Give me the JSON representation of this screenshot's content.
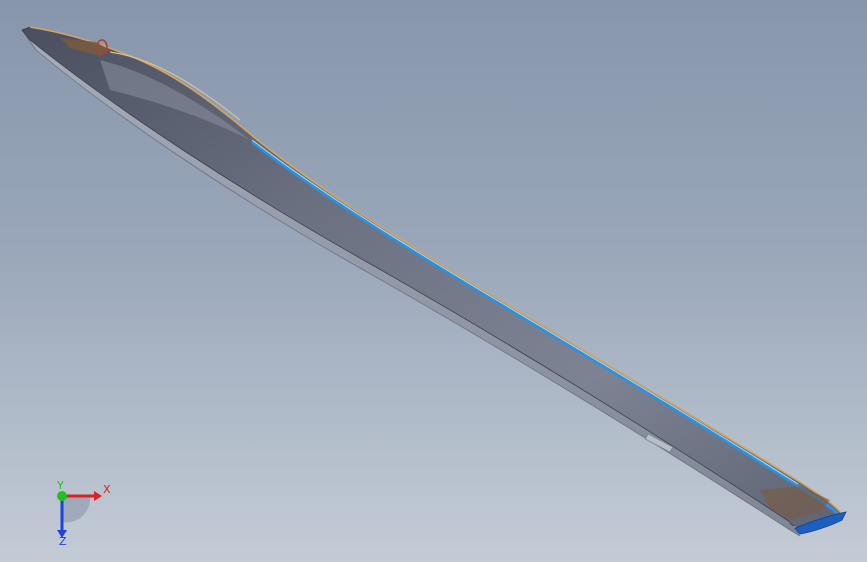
{
  "viewport": {
    "background_top": "#8796ac",
    "background_bottom": "#c3cbd6"
  },
  "model": {
    "body_color": "#5f6474",
    "underside_color": "#8f96a4",
    "edge_blue": "#2f8fe0",
    "edge_cyan": "#9fe3ff",
    "edge_orange": "#d9a45a",
    "tip_color": "#7a5a3f",
    "tail_blue": "#1d5fc0"
  },
  "triad": {
    "x_label": "X",
    "y_label": "Y",
    "z_label": "Z",
    "x_color": "#e02020",
    "y_color": "#20c020",
    "z_color": "#2040e0"
  }
}
